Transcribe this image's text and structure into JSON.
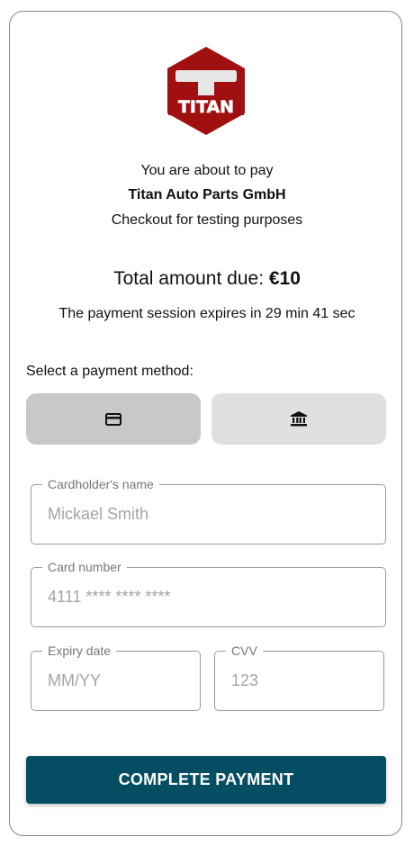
{
  "merchant": {
    "logo_text": "TITAN",
    "logo_colors": {
      "hexagon": "#a01010",
      "emblem": "#e6e6e6"
    }
  },
  "intro": {
    "line1": "You are about to pay",
    "merchant_name": "Titan Auto Parts GmbH",
    "description": "Checkout for testing purposes"
  },
  "total": {
    "label": "Total amount due:",
    "amount": "€10"
  },
  "session": {
    "expires_text": "The payment session expires in 29 min 41 sec"
  },
  "payment_method": {
    "label": "Select a payment method:",
    "options": [
      {
        "icon": "credit-card-icon",
        "selected": true
      },
      {
        "icon": "bank-icon",
        "selected": false
      }
    ]
  },
  "form": {
    "cardholder_name": {
      "label": "Cardholder's name",
      "placeholder": "Mickael Smith",
      "value": ""
    },
    "card_number": {
      "label": "Card number",
      "placeholder": "4111 **** **** ****",
      "value": ""
    },
    "expiry_date": {
      "label": "Expiry date",
      "placeholder": "MM/YY",
      "value": ""
    },
    "cvv": {
      "label": "CVV",
      "placeholder": "123",
      "value": ""
    }
  },
  "submit": {
    "label": "COMPLETE PAYMENT",
    "color": "#054d63"
  }
}
